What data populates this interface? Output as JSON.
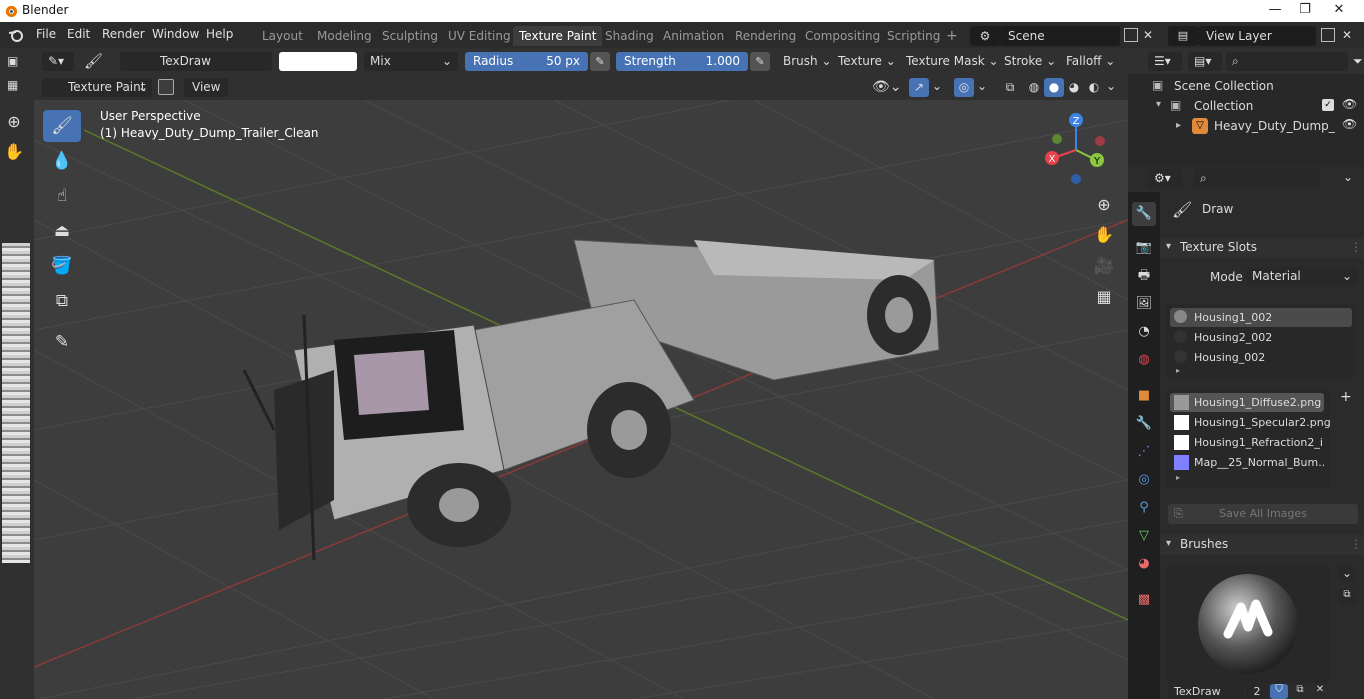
{
  "app": {
    "title": "Blender"
  },
  "window_controls": {
    "minimize": "—",
    "maximize": "❐",
    "close": "✕"
  },
  "menu": [
    "File",
    "Edit",
    "Render",
    "Window",
    "Help"
  ],
  "workspaces": [
    "Layout",
    "Modeling",
    "Sculpting",
    "UV Editing",
    "Texture Paint",
    "Shading",
    "Animation",
    "Rendering",
    "Compositing",
    "Scripting"
  ],
  "workspace_add": "+",
  "scene": {
    "name": "Scene"
  },
  "view_layer": {
    "name": "View Layer"
  },
  "tool_header": {
    "brush_name": "TexDraw",
    "blend": "Mix",
    "radius_label": "Radius",
    "radius_value": "50 px",
    "strength_label": "Strength",
    "strength_value": "1.000",
    "brush_menu": "Brush",
    "texture_menu": "Texture",
    "texture_mask_menu": "Texture Mask",
    "stroke_menu": "Stroke",
    "falloff_menu": "Falloff"
  },
  "mode_header": {
    "mode": "Texture Paint",
    "view": "View"
  },
  "viewport": {
    "perspective": "User Perspective",
    "object_label": "(1) Heavy_Duty_Dump_Trailer_Clean"
  },
  "gizmo": {
    "x": "X",
    "y": "Y",
    "z": "Z"
  },
  "outliner": {
    "scene_collection": "Scene Collection",
    "collection": "Collection",
    "object": "Heavy_Duty_Dump_"
  },
  "properties": {
    "brush_title": "Draw",
    "texture_slots_title": "Texture Slots",
    "mode_label": "Mode",
    "mode_value": "Material",
    "materials": [
      "Housing1_002",
      "Housing2_002",
      "Housing_002"
    ],
    "images": [
      "Housing1_Diffuse2.png",
      "Housing1_Specular2.png",
      "Housing1_Refraction2_i...",
      "Map__25_Normal_Bum..."
    ],
    "save_all_images": "Save All Images",
    "brushes_title": "Brushes",
    "brush_preview_name": "TexDraw",
    "brush_users": "2"
  },
  "colors": {
    "accent": "#4772b3",
    "axis_x": "#e8424e",
    "axis_y": "#8bc740",
    "axis_z": "#3c82e8",
    "header_bg": "#303030",
    "viewport_bg": "#3d3d3d"
  }
}
